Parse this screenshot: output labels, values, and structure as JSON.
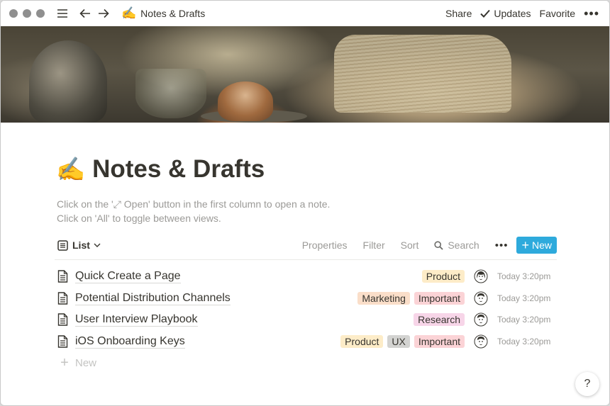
{
  "titlebar": {
    "page_emoji": "✍️",
    "page_title": "Notes & Drafts",
    "share_label": "Share",
    "updates_label": "Updates",
    "favorite_label": "Favorite",
    "more_label": "•••"
  },
  "page": {
    "emoji": "✍️",
    "title": "Notes & Drafts",
    "description_line1": "Click on the '⤢ Open' button in the first column to open a note.",
    "description_line2": "Click on 'All' to toggle between views."
  },
  "toolbar": {
    "view_label": "List",
    "properties_label": "Properties",
    "filter_label": "Filter",
    "sort_label": "Sort",
    "search_label": "Search",
    "more_label": "•••",
    "new_label": "New",
    "accent_color": "#2eaadc"
  },
  "rows": [
    {
      "title": "Quick Create a Page",
      "tags": [
        "Product"
      ],
      "time": "Today 3:20pm"
    },
    {
      "title": "Potential Distribution Channels",
      "tags": [
        "Marketing",
        "Important"
      ],
      "time": "Today 3:20pm"
    },
    {
      "title": "User Interview Playbook",
      "tags": [
        "Research"
      ],
      "time": "Today 3:20pm"
    },
    {
      "title": "iOS Onboarding Keys",
      "tags": [
        "Product",
        "UX",
        "Important"
      ],
      "time": "Today 3:20pm"
    }
  ],
  "new_row_label": "New",
  "help_label": "?",
  "icons": [
    "menu-icon",
    "back-arrow-icon",
    "forward-arrow-icon",
    "checkmark-icon",
    "list-view-icon",
    "chevron-down-icon",
    "search-icon",
    "plus-icon",
    "document-icon",
    "avatar-icon"
  ]
}
